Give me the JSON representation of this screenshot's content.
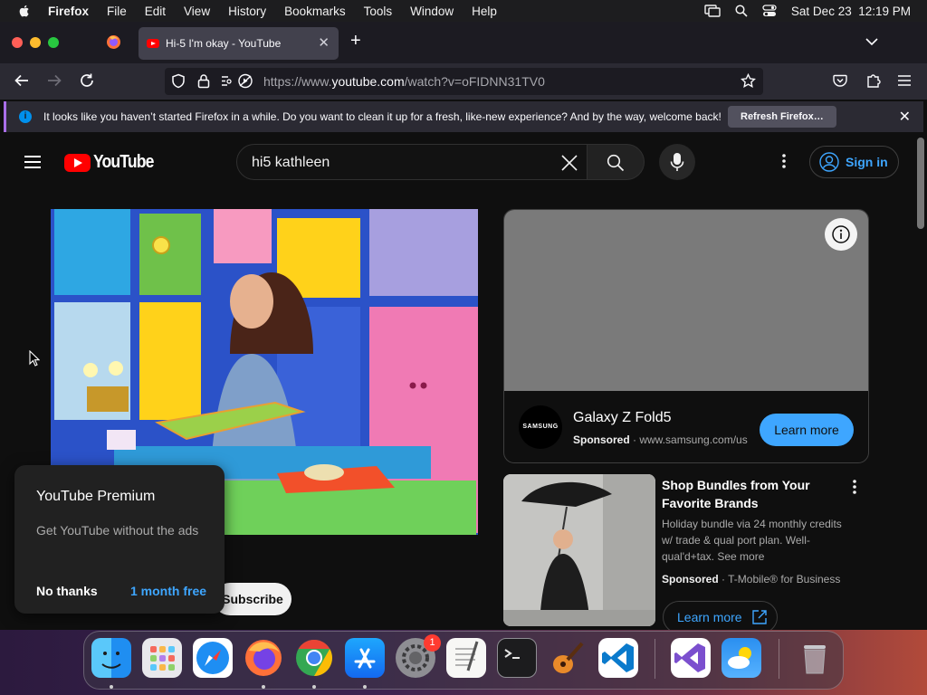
{
  "menubar": {
    "app": "Firefox",
    "menus": [
      "File",
      "Edit",
      "View",
      "History",
      "Bookmarks",
      "Tools",
      "Window",
      "Help"
    ],
    "datetime": "Sat Dec 23  12:19 PM"
  },
  "browser": {
    "tab_title": "Hi-5 I'm okay - YouTube",
    "url_prefix": "https://www.",
    "url_domain": "youtube.com",
    "url_path": "/watch?v=oFIDNN31TV0"
  },
  "notification": {
    "message": "It looks like you haven’t started Firefox in a while. Do you want to clean it up for a fresh, like-new experience? And by the way, welcome back!",
    "button": "Refresh Firefox…"
  },
  "youtube": {
    "logo_text": "YouTube",
    "search_query": "hi5 kathleen",
    "sign_in": "Sign in",
    "subscribe": "Subscribe"
  },
  "ad_card": {
    "brand": "SAMSUNG",
    "title": "Galaxy Z Fold5",
    "sponsored": "Sponsored",
    "domain": "www.samsung.com/us",
    "button": "Learn more"
  },
  "ad2": {
    "title": "Shop Bundles from Your Favorite Brands",
    "description": "Holiday bundle via 24 monthly credits w/ trade & qual port plan. Well-qual'd+tax. See more",
    "sponsored": "Sponsored",
    "advertiser": "T-Mobile® for Business",
    "button": "Learn more"
  },
  "premium_popup": {
    "title": "YouTube Premium",
    "body": "Get YouTube without the ads",
    "dismiss": "No thanks",
    "accept": "1 month free"
  },
  "dock": {
    "apps": [
      "finder-icon",
      "launchpad-icon",
      "safari-icon",
      "firefox-icon",
      "chrome-icon",
      "app-store-icon",
      "system-settings-icon",
      "textedit-icon",
      "terminal-icon",
      "garageband-icon",
      "vscode-icon",
      "visual-studio-icon",
      "weather-icon",
      "trash-icon"
    ],
    "settings_badge": "1"
  }
}
